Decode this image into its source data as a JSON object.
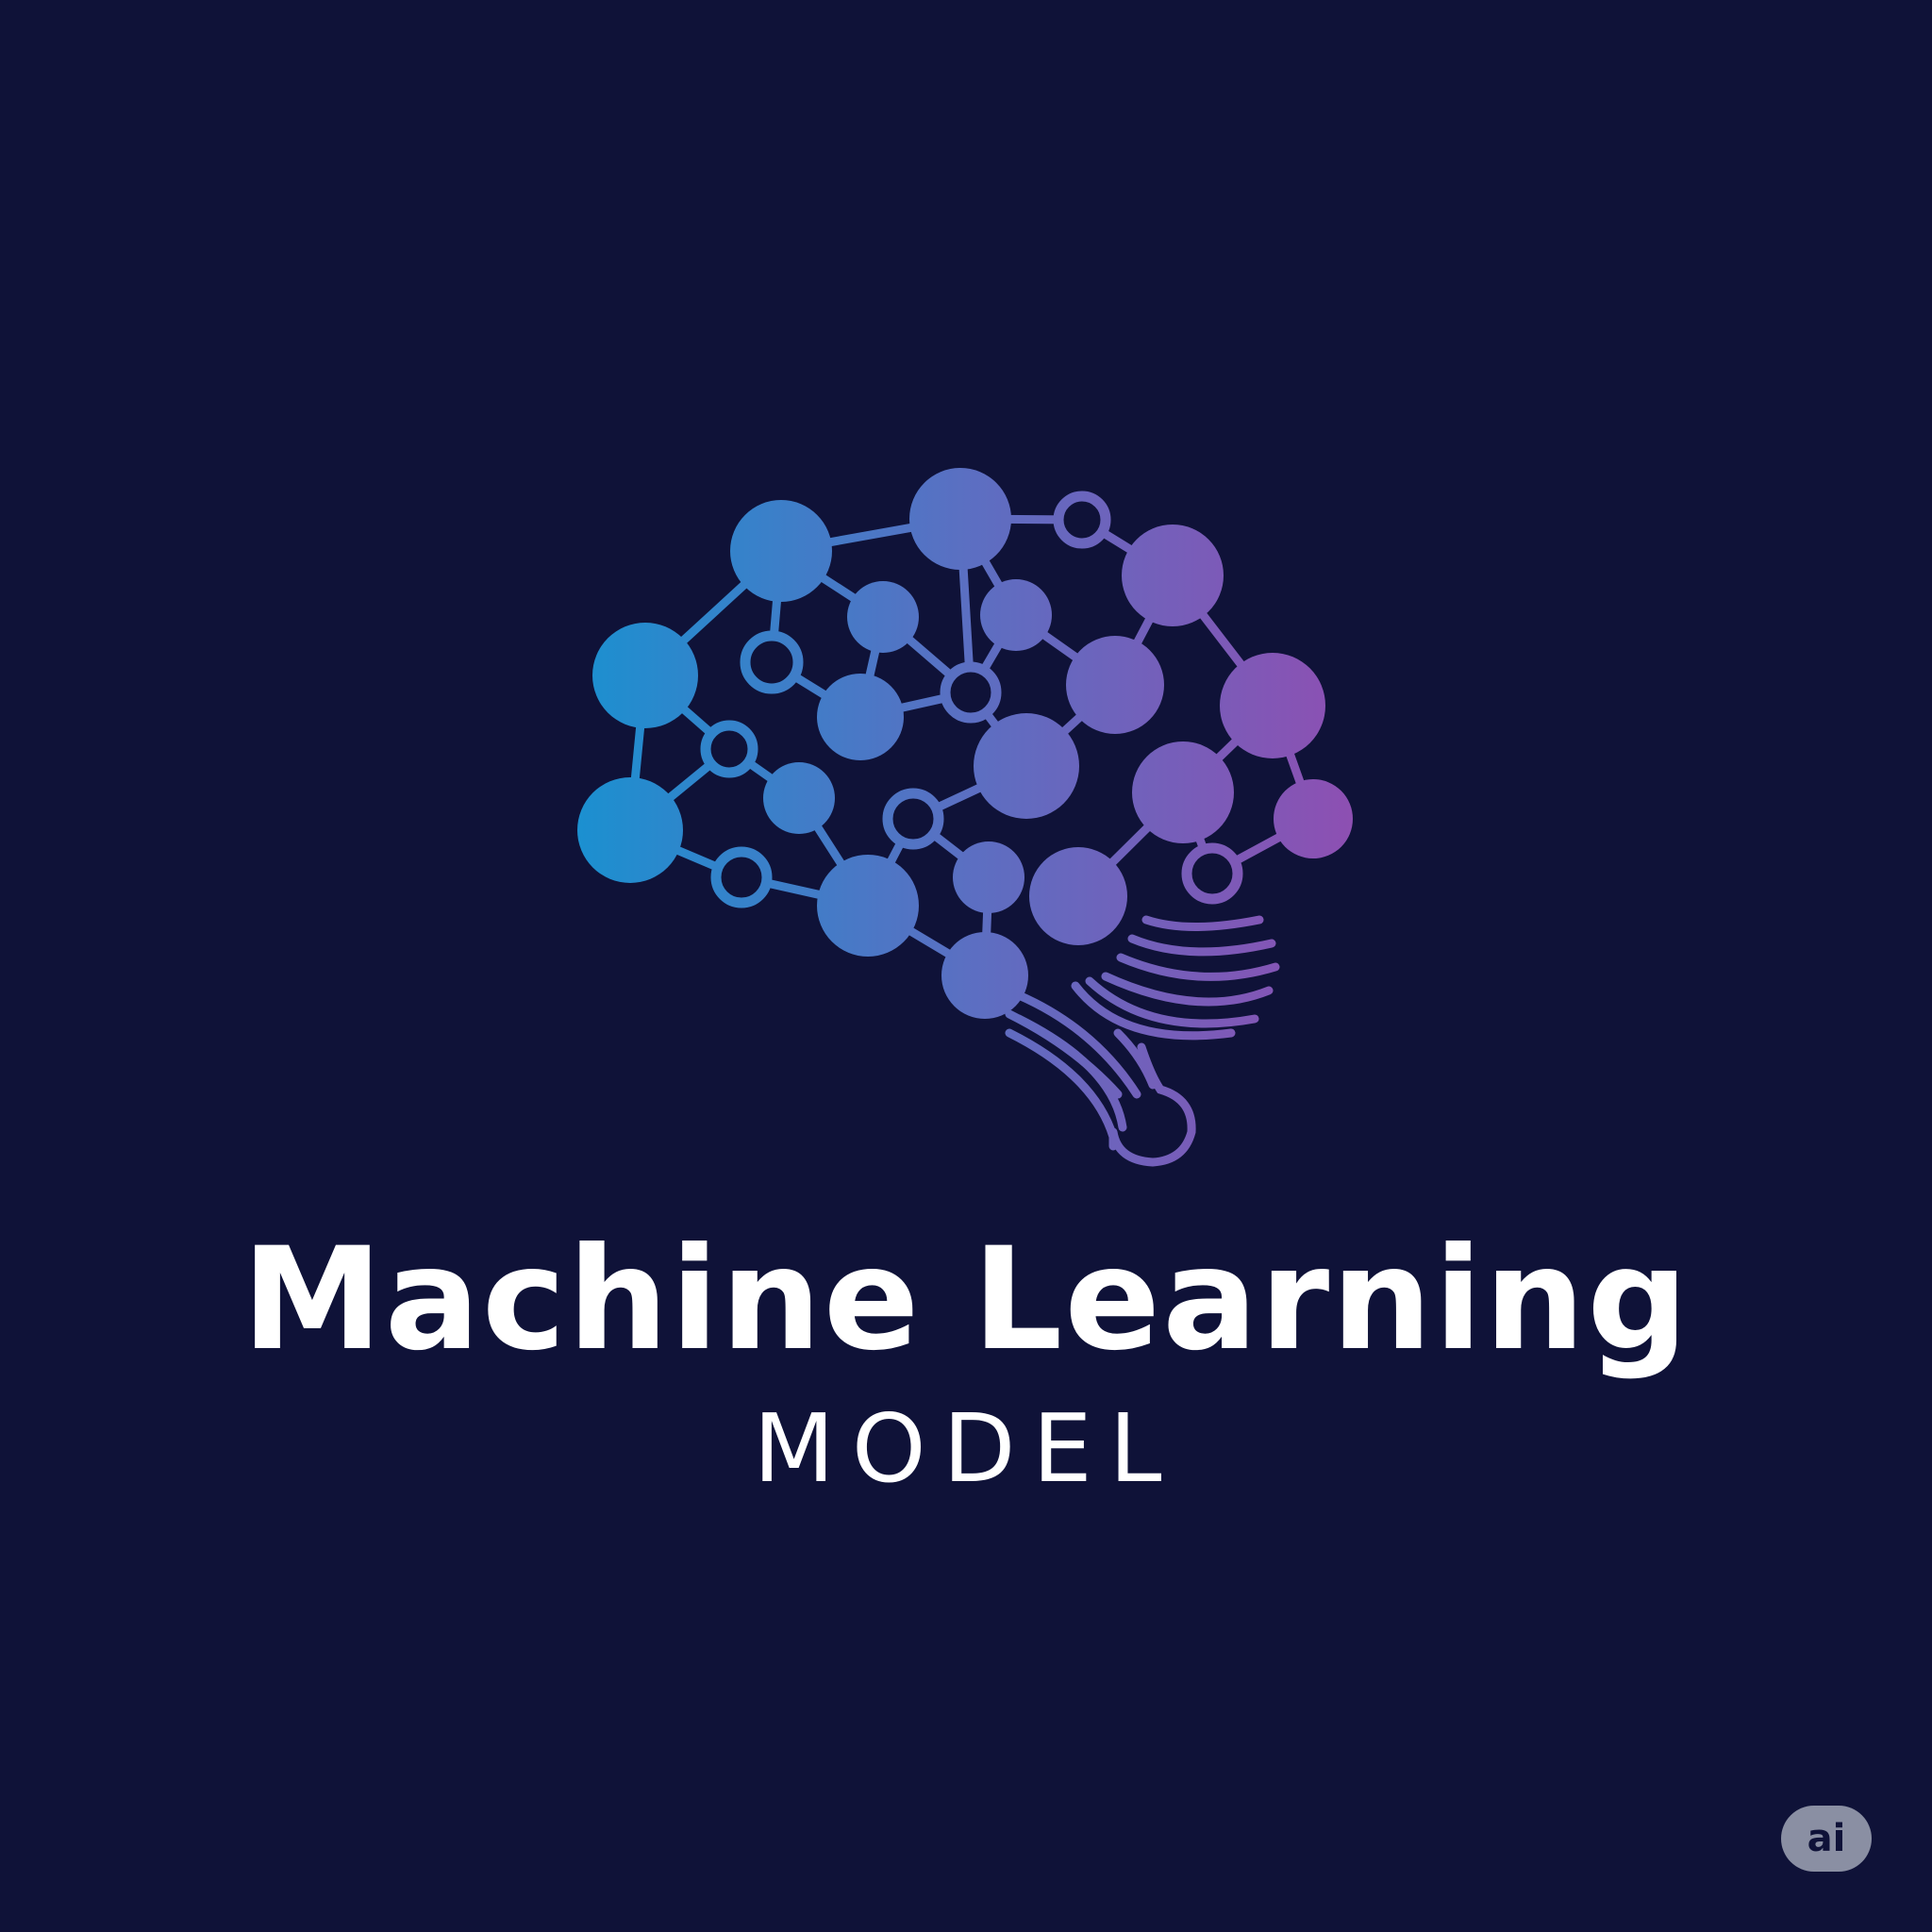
{
  "brand": {
    "title": "Machine Learning",
    "subtitle": "MODEL",
    "badge": "ai",
    "icon": "neural-network-brain-icon"
  },
  "colors": {
    "background": "#0f1238",
    "gradient_start": "#1b90d0",
    "gradient_mid": "#5b6fc2",
    "gradient_end": "#8e4fb2",
    "text": "#ffffff",
    "badge_bg": "#8a8fa3"
  }
}
